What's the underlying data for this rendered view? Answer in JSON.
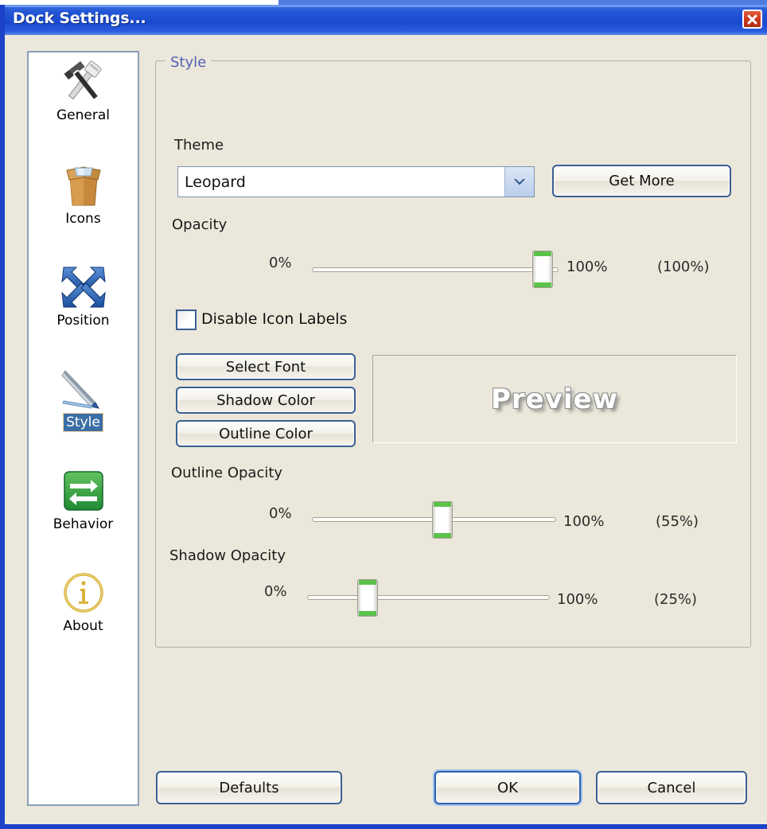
{
  "window": {
    "title": "Dock Settings...",
    "close_icon": "close-icon"
  },
  "colors": {
    "titlebar_blue": "#1a49cf",
    "window_bg": "#ebe8db",
    "group_title": "#5560b8",
    "selection_blue": "#3b6ea5",
    "slider_green": "#5cc24a",
    "close_red": "#cf3c20"
  },
  "sidebar": {
    "items": [
      {
        "label": "General",
        "icon": "hammer-wrench-icon",
        "selected": false
      },
      {
        "label": "Icons",
        "icon": "open-box-icon",
        "selected": false
      },
      {
        "label": "Position",
        "icon": "four-arrows-icon",
        "selected": false
      },
      {
        "label": "Style",
        "icon": "pen-icon",
        "selected": true
      },
      {
        "label": "Behavior",
        "icon": "green-swap-arrows-icon",
        "selected": false
      },
      {
        "label": "About",
        "icon": "info-circle-icon",
        "selected": false
      }
    ]
  },
  "main": {
    "group_title": "Style",
    "theme": {
      "label": "Theme",
      "value": "Leopard",
      "arrow_icon": "chevron-down-icon",
      "get_more_label": "Get More"
    },
    "opacity": {
      "label": "Opacity",
      "min": "0%",
      "max": "100%",
      "current": "(100%)",
      "value": 100
    },
    "disable_icon_labels": {
      "label": "Disable Icon Labels",
      "checked": false
    },
    "font_buttons": [
      {
        "label": "Select Font"
      },
      {
        "label": "Shadow Color"
      },
      {
        "label": "Outline Color"
      }
    ],
    "preview": {
      "text": "Preview"
    },
    "outline_opacity": {
      "label": "Outline Opacity",
      "min": "0%",
      "max": "100%",
      "current": "(55%)",
      "value": 55
    },
    "shadow_opacity": {
      "label": "Shadow Opacity",
      "min": "0%",
      "max": "100%",
      "current": "(25%)",
      "value": 25
    }
  },
  "footer": {
    "defaults_label": "Defaults",
    "ok_label": "OK",
    "cancel_label": "Cancel"
  }
}
